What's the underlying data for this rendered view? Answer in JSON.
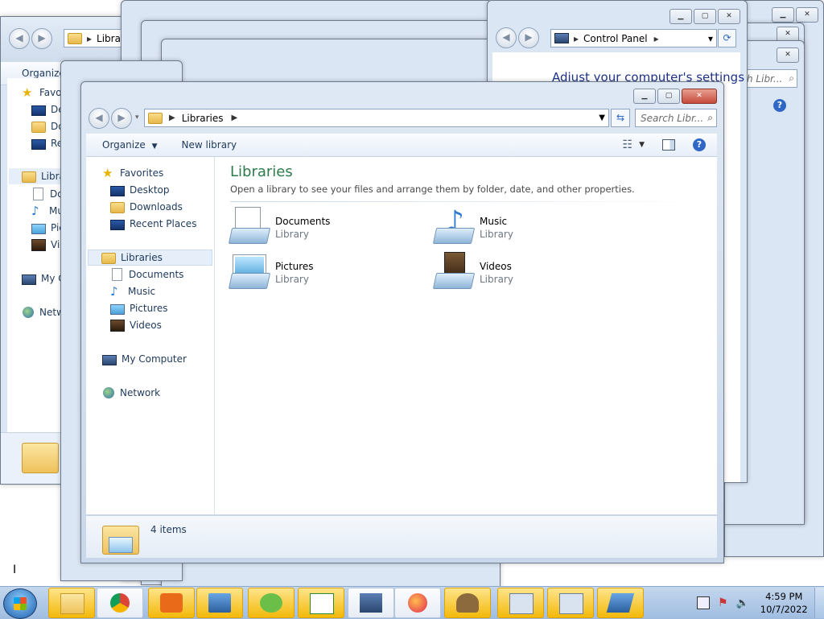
{
  "bg_windows": {
    "w1": {
      "addr": "Libra",
      "organize": "Organize",
      "favorites": "Favo",
      "desktop": "Des",
      "downloads": "Dov",
      "recent": "Rec",
      "libraries": "Libra",
      "documents": "Do",
      "music": "Mu",
      "pictures": "Pic",
      "videos": "Vid",
      "computer": "My C",
      "network": "Netw"
    },
    "cp": {
      "addr": "Control Panel",
      "heading": "Adjust your computer's settings",
      "search": "h Libr..."
    }
  },
  "main": {
    "address_path": "Libraries",
    "search_placeholder": "Search Libr...",
    "toolbar": {
      "organize": "Organize",
      "new_library": "New library"
    },
    "nav": {
      "favorites": "Favorites",
      "desktop": "Desktop",
      "downloads": "Downloads",
      "recent_places": "Recent Places",
      "libraries": "Libraries",
      "documents": "Documents",
      "music": "Music",
      "pictures": "Pictures",
      "videos": "Videos",
      "computer": "My Computer",
      "network": "Network"
    },
    "heading": "Libraries",
    "subheading": "Open a library to see your files and arrange them by folder, date, and other properties.",
    "libraries": [
      {
        "name": "Documents",
        "type": "Library",
        "icon": "documents-library-icon"
      },
      {
        "name": "Music",
        "type": "Library",
        "icon": "music-library-icon"
      },
      {
        "name": "Pictures",
        "type": "Library",
        "icon": "pictures-library-icon"
      },
      {
        "name": "Videos",
        "type": "Library",
        "icon": "videos-library-icon"
      }
    ],
    "status": "4 items"
  },
  "taskbar": {
    "time": "4:59 PM",
    "date": "10/7/2022",
    "buttons": [
      "explorer",
      "chrome",
      "media-player",
      "control-panel",
      "sync",
      "notepad",
      "computer",
      "firefox",
      "installer",
      "clock-app-1",
      "clock-app-2",
      "display"
    ]
  }
}
